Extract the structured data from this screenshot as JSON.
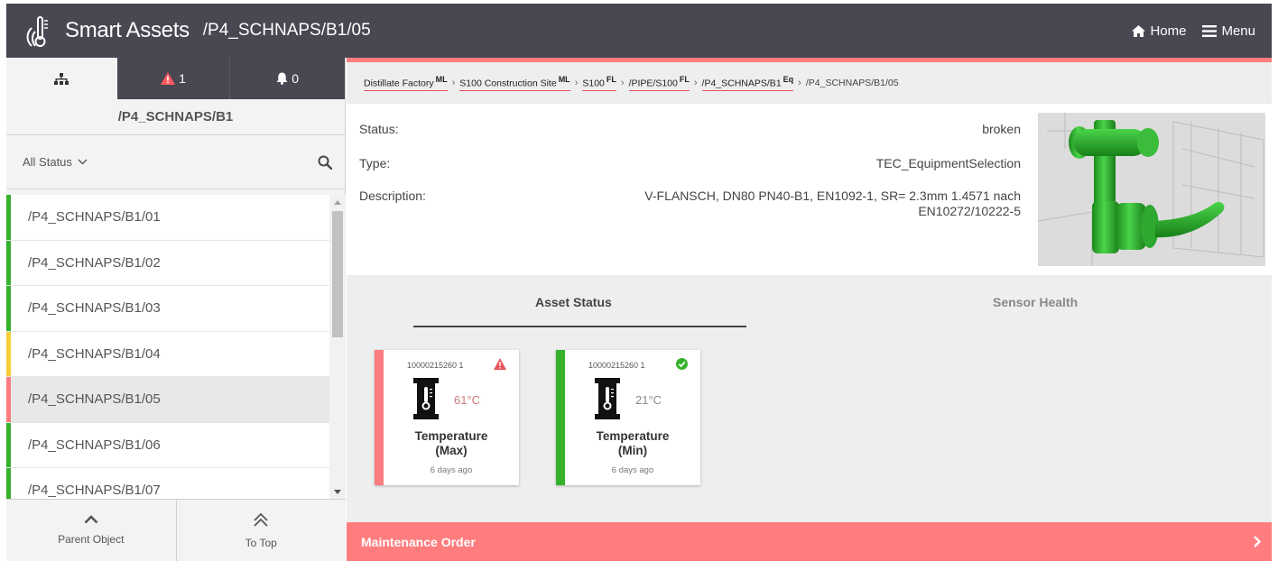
{
  "header": {
    "app_title": "Smart Assets",
    "path_title": "/P4_SCHNAPS/B1/05",
    "home_label": "Home",
    "menu_label": "Menu"
  },
  "left_panel": {
    "tabs": {
      "alerts_count": "1",
      "notifications_count": "0"
    },
    "parent_name": "/P4_SCHNAPS/B1",
    "status_filter": "All Status",
    "items": [
      {
        "label": "/P4_SCHNAPS/B1/01",
        "status_color": "#35b12c",
        "selected": false
      },
      {
        "label": "/P4_SCHNAPS/B1/02",
        "status_color": "#35b12c",
        "selected": false
      },
      {
        "label": "/P4_SCHNAPS/B1/03",
        "status_color": "#35b12c",
        "selected": false
      },
      {
        "label": "/P4_SCHNAPS/B1/04",
        "status_color": "#f5cd37",
        "selected": false
      },
      {
        "label": "/P4_SCHNAPS/B1/05",
        "status_color": "#ff7d7e",
        "selected": true
      },
      {
        "label": "/P4_SCHNAPS/B1/06",
        "status_color": "#35b12c",
        "selected": false
      },
      {
        "label": "/P4_SCHNAPS/B1/07",
        "status_color": "#35b12c",
        "selected": false
      }
    ],
    "parent_object_label": "Parent Object",
    "to_top_label": "To Top"
  },
  "breadcrumb": {
    "items": [
      {
        "label": "Distillate Factory",
        "tag": "ML"
      },
      {
        "label": "S100 Construction Site",
        "tag": "ML"
      },
      {
        "label": "S100",
        "tag": "FL"
      },
      {
        "label": "/PIPE/S100",
        "tag": "FL"
      },
      {
        "label": "/P4_SCHNAPS/B1",
        "tag": "Eq"
      }
    ],
    "current": "/P4_SCHNAPS/B1/05"
  },
  "details": {
    "status_label": "Status:",
    "status_value": "broken",
    "type_label": "Type:",
    "type_value": "TEC_EquipmentSelection",
    "description_label": "Description:",
    "description_line1": "V-FLANSCH, DN80 PN40-B1, EN1092-1, SR= 2.3mm 1.4571 nach",
    "description_line2": "EN10272/10222-5"
  },
  "section_tabs": {
    "asset_status": "Asset Status",
    "sensor_health": "Sensor Health"
  },
  "cards": [
    {
      "id": "10000215260 1",
      "value": "61°C",
      "name_line1": "Temperature",
      "name_line2": "(Max)",
      "time": "6 days ago",
      "status": "alert",
      "bar_color": "#ff7d7e",
      "value_color": "#c97a7a"
    },
    {
      "id": "10000215260 1",
      "value": "21°C",
      "name_line1": "Temperature",
      "name_line2": "(Min)",
      "time": "6 days ago",
      "status": "ok",
      "bar_color": "#35b12c",
      "value_color": "#8a8a8a"
    }
  ],
  "maintenance": {
    "label": "Maintenance Order"
  },
  "colors": {
    "header_bg": "#484752",
    "accent_red": "#ff7d7e",
    "ok_green": "#35b12c",
    "warn_yellow": "#f5cd37",
    "alert_icon": "#e8545a"
  }
}
